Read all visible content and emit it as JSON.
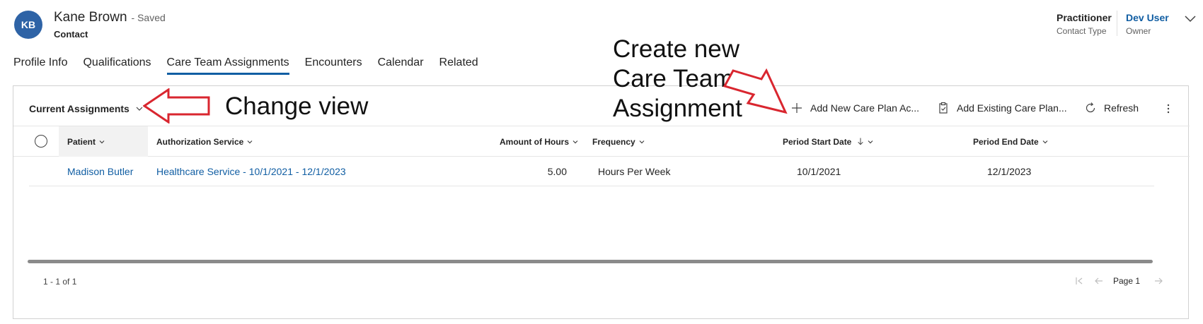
{
  "header": {
    "avatar_initials": "KB",
    "record_name": "Kane Brown",
    "save_status": "- Saved",
    "record_type": "Contact",
    "fields": [
      {
        "value": "Practitioner",
        "label": "Contact Type"
      },
      {
        "value": "Dev User",
        "label": "Owner"
      }
    ]
  },
  "tabs": [
    {
      "label": "Profile Info",
      "active": false
    },
    {
      "label": "Qualifications",
      "active": false
    },
    {
      "label": "Care Team Assignments",
      "active": true
    },
    {
      "label": "Encounters",
      "active": false
    },
    {
      "label": "Calendar",
      "active": false
    },
    {
      "label": "Related",
      "active": false
    }
  ],
  "toolbar": {
    "view_selector": "Current Assignments",
    "add_new_label": "Add New Care Plan Ac...",
    "add_existing_label": "Add Existing Care Plan...",
    "refresh_label": "Refresh"
  },
  "grid": {
    "columns": [
      "Patient",
      "Authorization Service",
      "Amount of Hours",
      "Frequency",
      "Period Start Date",
      "Period End Date"
    ],
    "sorted_column": "Period Start Date",
    "rows": [
      {
        "patient": "Madison Butler",
        "authorization_service": "Healthcare Service - 10/1/2021 - 12/1/2023",
        "amount_of_hours": "5.00",
        "frequency": "Hours Per Week",
        "period_start_date": "10/1/2021",
        "period_end_date": "12/1/2023"
      }
    ]
  },
  "footer": {
    "record_count": "1 - 1 of 1",
    "page_label": "Page 1"
  },
  "annotations": {
    "change_view": "Change view",
    "create_new_line1": "Create new",
    "create_new_line2": "Care Team",
    "create_new_line3": "Assignment"
  },
  "colors": {
    "accent": "#115ea3",
    "avatar_bg": "#2e63a6",
    "annotation_arrow": "#d9262f"
  },
  "icons": {
    "add": "plus-icon",
    "add_existing": "clipboard-icon",
    "refresh": "refresh-icon",
    "more": "more-vertical-icon",
    "sort_desc": "arrow-down-icon"
  }
}
